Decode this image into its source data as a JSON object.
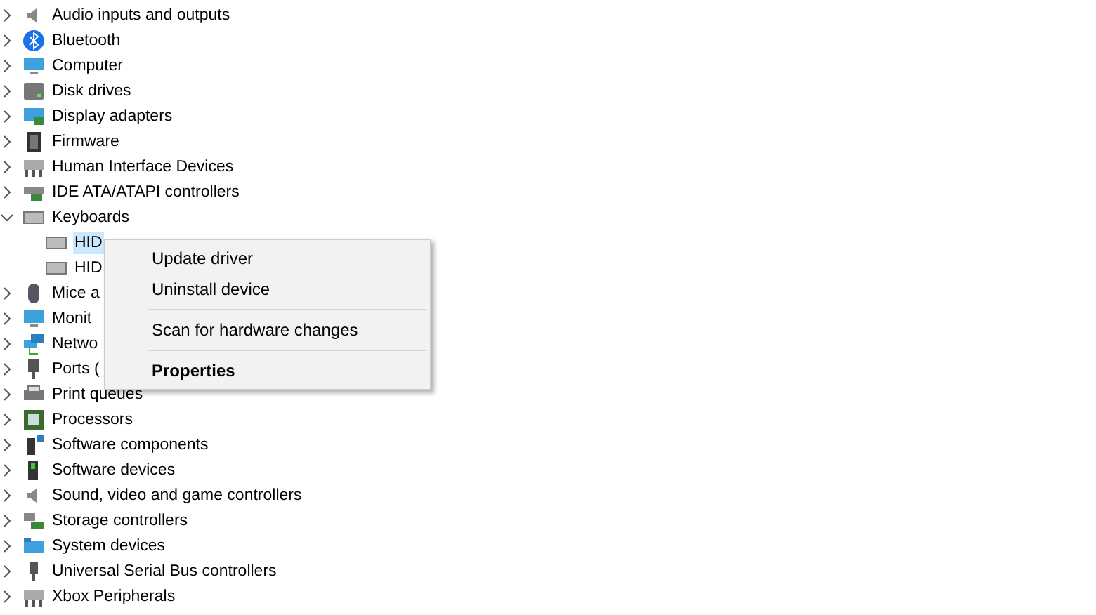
{
  "tree": [
    {
      "label": "Audio inputs and outputs",
      "expanded": false
    },
    {
      "label": "Bluetooth",
      "expanded": false
    },
    {
      "label": "Computer",
      "expanded": false
    },
    {
      "label": "Disk drives",
      "expanded": false
    },
    {
      "label": "Display adapters",
      "expanded": false
    },
    {
      "label": "Firmware",
      "expanded": false
    },
    {
      "label": "Human Interface Devices",
      "expanded": false
    },
    {
      "label": "IDE ATA/ATAPI controllers",
      "expanded": false
    },
    {
      "label": "Keyboards",
      "expanded": true,
      "children": [
        {
          "label": "HID",
          "selected": true
        },
        {
          "label": "HID",
          "selected": false
        }
      ]
    },
    {
      "label": "Mice a",
      "expanded": false
    },
    {
      "label": "Monit",
      "expanded": false
    },
    {
      "label": "Netwo",
      "expanded": false
    },
    {
      "label": "Ports (",
      "expanded": false
    },
    {
      "label": "Print queues",
      "expanded": false
    },
    {
      "label": "Processors",
      "expanded": false
    },
    {
      "label": "Software components",
      "expanded": false
    },
    {
      "label": "Software devices",
      "expanded": false
    },
    {
      "label": "Sound, video and game controllers",
      "expanded": false
    },
    {
      "label": "Storage controllers",
      "expanded": false
    },
    {
      "label": "System devices",
      "expanded": false
    },
    {
      "label": "Universal Serial Bus controllers",
      "expanded": false
    },
    {
      "label": "Xbox Peripherals",
      "expanded": false
    }
  ],
  "context_menu": {
    "groups": [
      [
        {
          "label": "Update driver",
          "default": false
        },
        {
          "label": "Uninstall device",
          "default": false
        }
      ],
      [
        {
          "label": "Scan for hardware changes",
          "default": false
        }
      ],
      [
        {
          "label": "Properties",
          "default": true
        }
      ]
    ]
  }
}
